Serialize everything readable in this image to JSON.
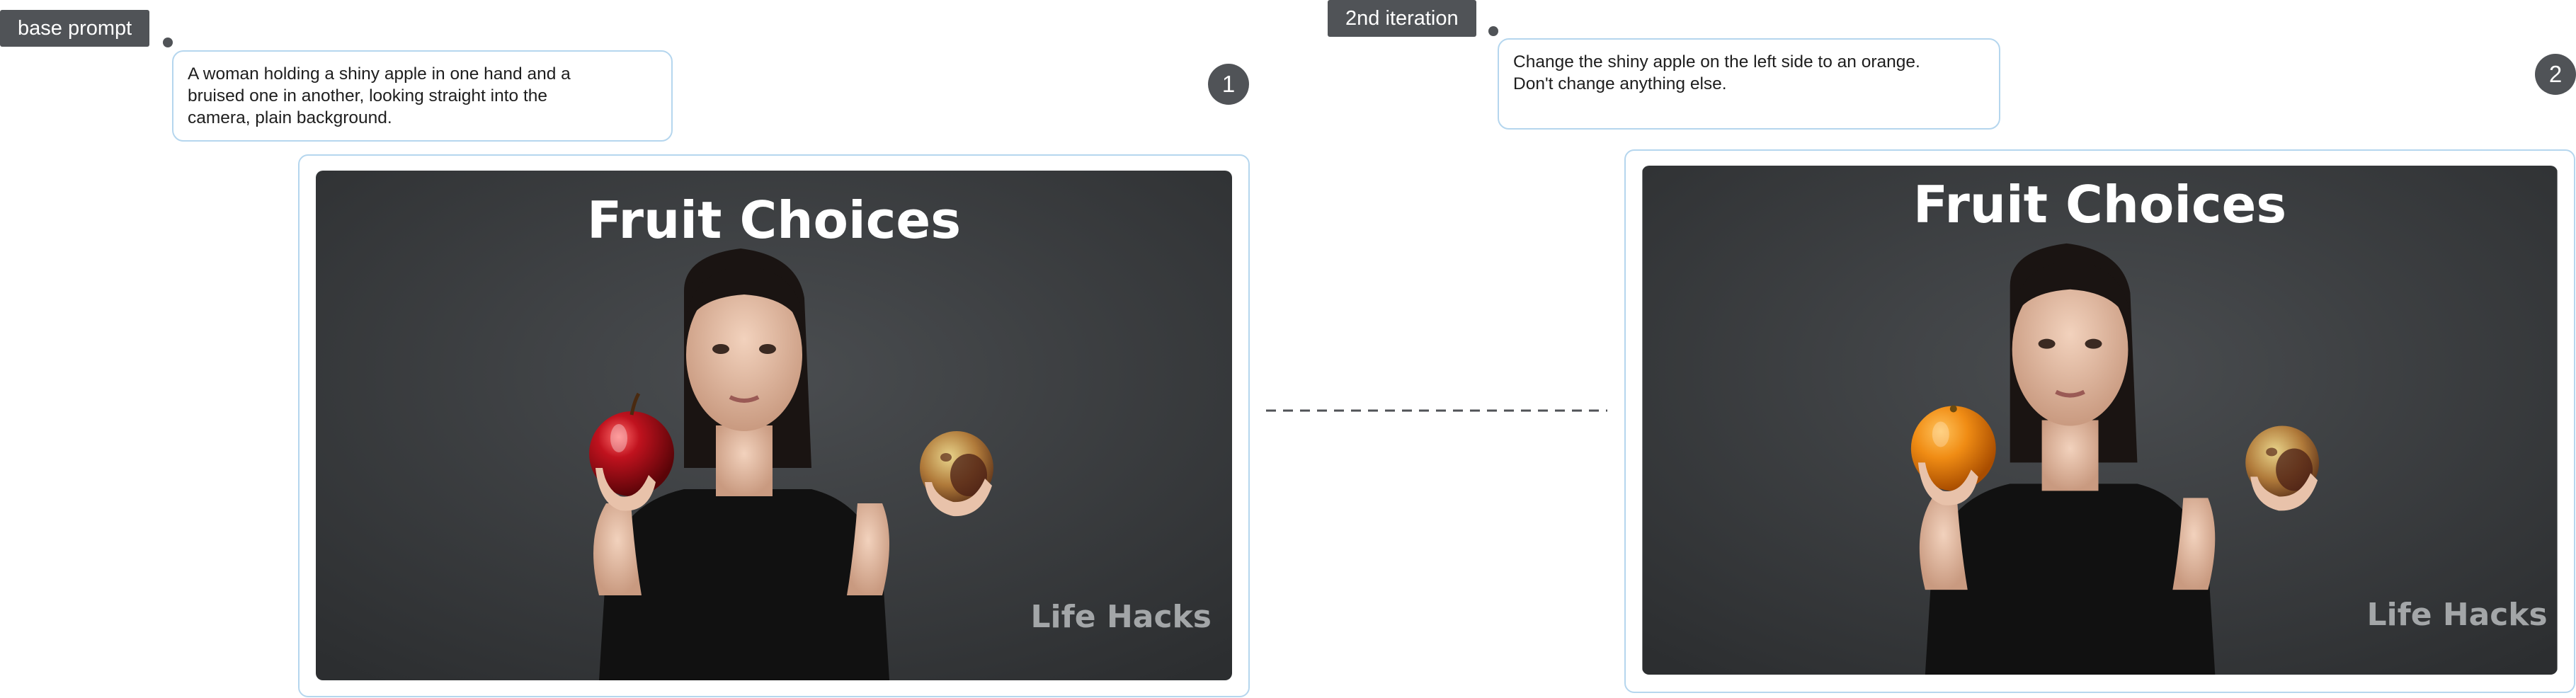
{
  "steps": [
    {
      "tag_label": "base prompt",
      "prompt_lines": [
        "A woman holding a shiny apple in one hand and a",
        "bruised one in another, looking straight into the",
        "camera, plain background."
      ],
      "number": "1",
      "image": {
        "title": "Fruit Choices",
        "watermark": "Life Hacks",
        "left_hand_fruit": "shiny-red-apple",
        "right_hand_fruit": "bruised-apple"
      }
    },
    {
      "tag_label": "2nd iteration",
      "prompt_lines": [
        "Change the shiny apple on the left side to an orange.",
        "Don't change anything else."
      ],
      "number": "2",
      "image": {
        "title": "Fruit Choices",
        "watermark": "Life Hacks",
        "left_hand_fruit": "orange",
        "right_hand_fruit": "bruised-apple"
      }
    }
  ],
  "colors": {
    "tag_bg": "#505357",
    "note_border": "#b5d6ee",
    "photo_bg": "#3a3d3f",
    "title_text": "#ffffff",
    "watermark_text": "#a3a6a8",
    "apple_red": "#b3141e",
    "orange": "#f08c14"
  }
}
